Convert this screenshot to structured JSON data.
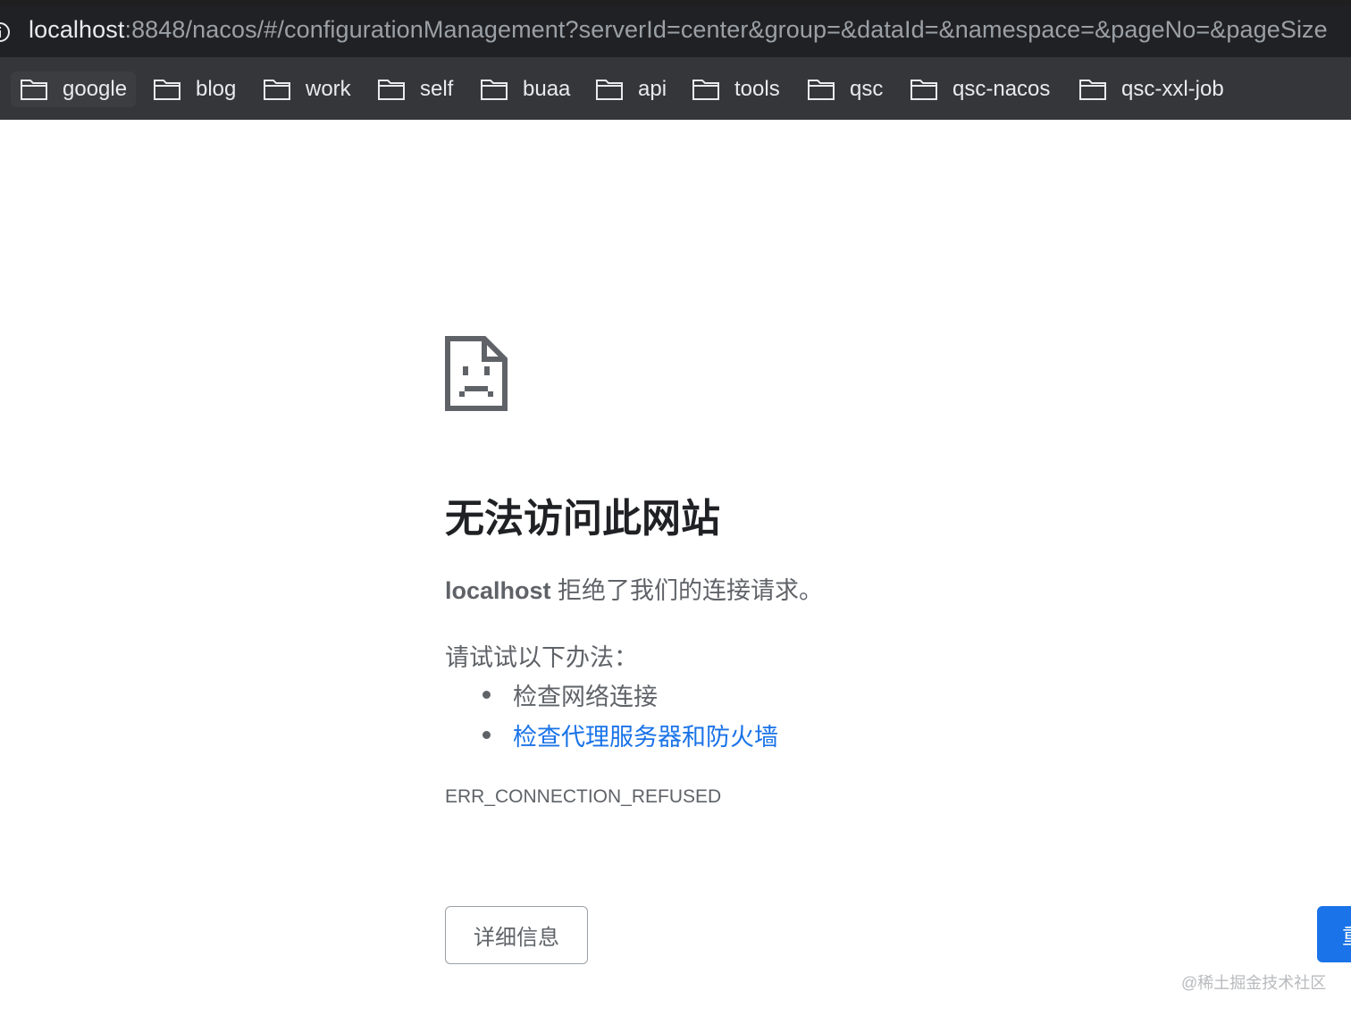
{
  "browser": {
    "url_host": "localhost",
    "url_rest": ":8848/nacos/#/configurationManagement?serverId=center&group=&dataId=&namespace=&pageNo=&pageSize",
    "info_icon": "info-icon"
  },
  "bookmarks": [
    {
      "label": "google",
      "icon": "folder-icon"
    },
    {
      "label": "blog",
      "icon": "folder-icon"
    },
    {
      "label": "work",
      "icon": "folder-icon"
    },
    {
      "label": "self",
      "icon": "folder-icon"
    },
    {
      "label": "buaa",
      "icon": "folder-icon"
    },
    {
      "label": "api",
      "icon": "folder-icon"
    },
    {
      "label": "tools",
      "icon": "folder-icon"
    },
    {
      "label": "qsc",
      "icon": "folder-icon"
    },
    {
      "label": "qsc-nacos",
      "icon": "folder-icon"
    },
    {
      "label": "qsc-xxl-job",
      "icon": "folder-icon"
    }
  ],
  "error": {
    "icon": "sad-page-icon",
    "heading": "无法访问此网站",
    "host": "localhost",
    "message": "拒绝了我们的连接请求。",
    "try_label": "请试试以下办法：",
    "suggestions": [
      "检查网络连接",
      "检查代理服务器和防火墙"
    ],
    "code": "ERR_CONNECTION_REFUSED",
    "details_button": "详细信息",
    "reload_button": "重"
  },
  "watermark": "@稀土掘金技术社区",
  "colors": {
    "link": "#1a73e8",
    "primary_button": "#1a73e8",
    "text_secondary": "#5f6368",
    "heading": "#202124"
  }
}
